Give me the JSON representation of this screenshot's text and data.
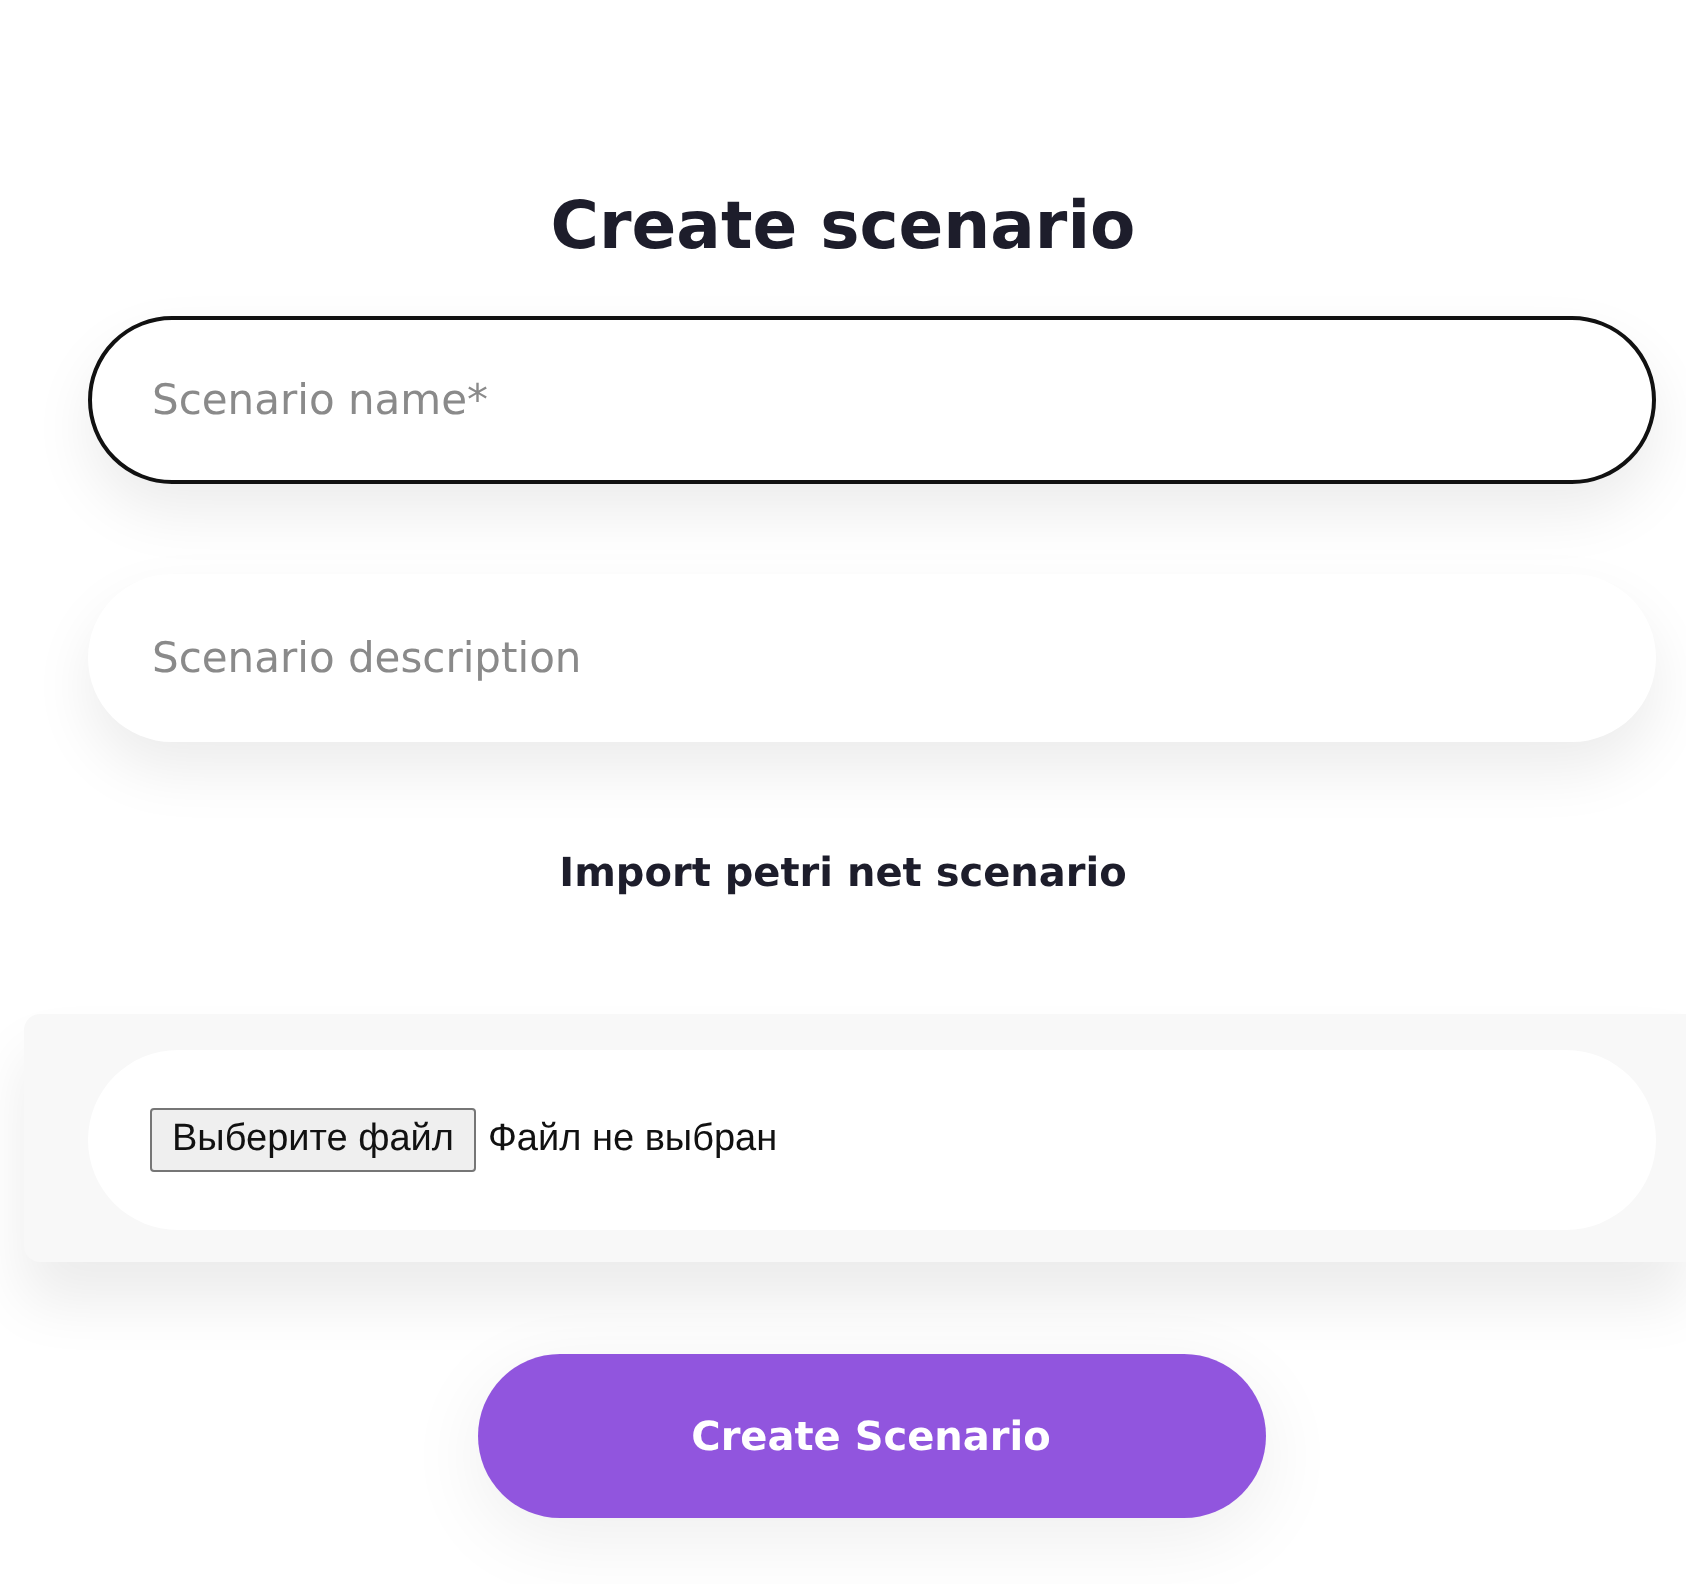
{
  "title": "Create scenario",
  "fields": [
    {
      "placeholder": "Scenario name*",
      "focused": true
    },
    {
      "placeholder": "Scenario description",
      "focused": false
    }
  ],
  "import": {
    "heading": "Import petri net scenario",
    "choose_button": "Выберите файл",
    "status": "Файл не выбран"
  },
  "submit_button": "Create Scenario"
}
